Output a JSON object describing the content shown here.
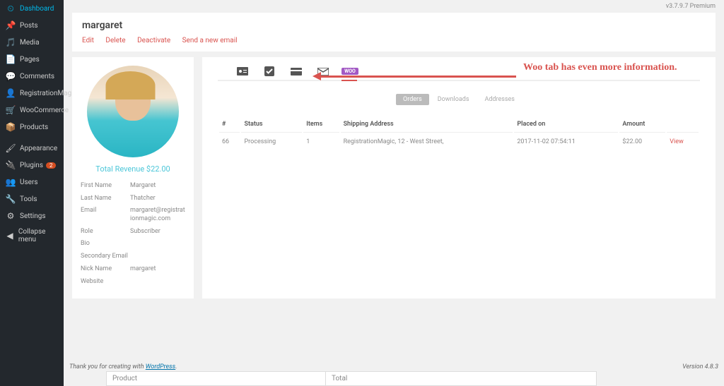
{
  "version_top": "v3.7.9.7 Premium",
  "sidebar": {
    "items": [
      {
        "label": "Dashboard",
        "icon": "⏲"
      },
      {
        "label": "Posts",
        "icon": "📌"
      },
      {
        "label": "Media",
        "icon": "🖼"
      },
      {
        "label": "Pages",
        "icon": "📄"
      },
      {
        "label": "Comments",
        "icon": "💬"
      },
      {
        "label": "RegistrationMagic",
        "icon": "👤"
      },
      {
        "label": "WooCommerce",
        "icon": "🛒"
      },
      {
        "label": "Products",
        "icon": "📦"
      },
      {
        "label": "Appearance",
        "icon": "🖌"
      },
      {
        "label": "Plugins",
        "icon": "🔌",
        "badge": "2"
      },
      {
        "label": "Users",
        "icon": "👥"
      },
      {
        "label": "Tools",
        "icon": "🔧"
      },
      {
        "label": "Settings",
        "icon": "⚙"
      },
      {
        "label": "Collapse menu",
        "icon": "◀"
      }
    ]
  },
  "header": {
    "title": "margaret",
    "actions": [
      "Edit",
      "Delete",
      "Deactivate",
      "Send a new email"
    ]
  },
  "profile": {
    "revenue_label": "Total Revenue $22.00",
    "fields": [
      {
        "label": "First Name",
        "value": "Margaret"
      },
      {
        "label": "Last Name",
        "value": "Thatcher"
      },
      {
        "label": "Email",
        "value": "margaret@registrationmagic.com"
      },
      {
        "label": "Role",
        "value": "Subscriber"
      },
      {
        "label": "Bio",
        "value": ""
      },
      {
        "label": "Secondary Email",
        "value": ""
      },
      {
        "label": "Nick Name",
        "value": "margaret"
      },
      {
        "label": "Website",
        "value": ""
      }
    ]
  },
  "detail": {
    "woo_chip": "WOO",
    "subtabs": [
      "Orders",
      "Downloads",
      "Addresses"
    ],
    "table": {
      "headers": [
        "#",
        "Status",
        "Items",
        "Shipping Address",
        "Placed on",
        "Amount",
        ""
      ],
      "row": {
        "num": "66",
        "status": "Processing",
        "items": "1",
        "ship": "RegistrationMagic, 12 - West Street,",
        "placed": "2017-11-02 07:54:11",
        "amount": "$22.00",
        "action": "View"
      }
    }
  },
  "annotation": "Woo tab has even more information.",
  "footer": {
    "thanks_prefix": "Thank you for creating with ",
    "thanks_link": "WordPress",
    "version": "Version 4.8.3"
  },
  "bottom": {
    "c1": "Product",
    "c2": "Total"
  }
}
